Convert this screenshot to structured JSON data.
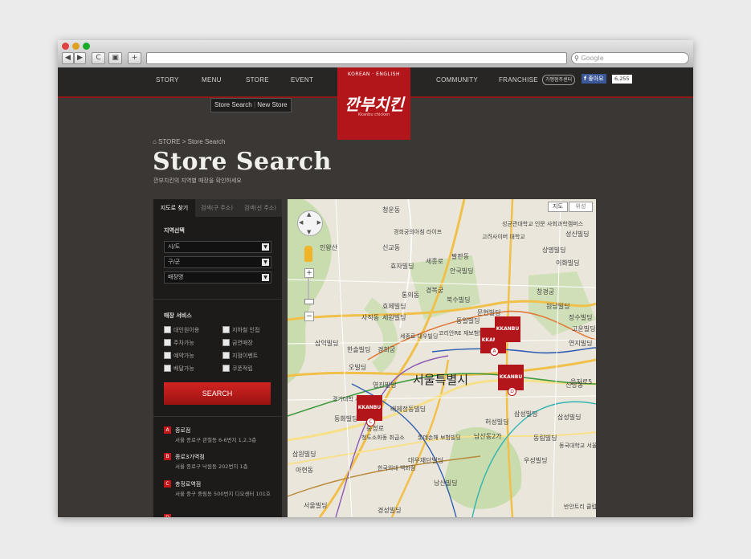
{
  "browser": {
    "search_placeholder": "Google",
    "back": "◀",
    "forward": "▶",
    "reload": "C",
    "add": "+"
  },
  "nav": {
    "left": [
      "STORY",
      "MENU",
      "STORE",
      "EVENT"
    ],
    "right": [
      "COMMUNITY",
      "FRANCHISE"
    ],
    "franchise_badge": "가맹점주센터",
    "like_label": "좋아요",
    "like_count": "6,255"
  },
  "logo": {
    "lang": "KOREAN  ·  ENGLISH",
    "text": "깐부치킨",
    "sub": "Kkanbu chicken"
  },
  "subnav": {
    "search": "Store Search",
    "new": "New Store"
  },
  "breadcrumb": "STORE > Store Search",
  "page": {
    "title": "Store Search",
    "subtitle": "깐부치킨의 지역별 매장을 확인하세요"
  },
  "sidebar": {
    "tabs": [
      "지도로 찾기",
      "검색(구 주소)",
      "검색(신 주소)"
    ],
    "region_label": "지역선택",
    "selects": [
      "시/도",
      "구/군",
      "매장명"
    ],
    "service_label": "매장 서비스",
    "services": [
      "대인원이용",
      "지하철 인접",
      "주차가능",
      "금연매장",
      "예약가능",
      "지점이벤트",
      "배달가능",
      "쿠폰적립"
    ],
    "search_button": "SEARCH",
    "results": [
      {
        "letter": "A",
        "name": "종로점",
        "address": "서울 종로구 관철동 6-6번지 1,2,3층"
      },
      {
        "letter": "B",
        "name": "종로3가역점",
        "address": "서울 종로구 낙원동 202번지 1층"
      },
      {
        "letter": "C",
        "name": "충정로역점",
        "address": "서울 중구 중림동 500번지 디오센터 101호"
      }
    ]
  },
  "map": {
    "type_buttons": [
      "지도",
      "위성"
    ],
    "marker_label": "KKANBU",
    "markers": [
      "A",
      "B",
      "C",
      "D"
    ],
    "center_label": "서울특별시",
    "labels": [
      "청운동",
      "인왕산",
      "신교동",
      "경희궁의아침 라이프",
      "효자빌딩",
      "세종로",
      "팔판동",
      "안국빌딩",
      "고려사이버 대학교",
      "성균관대학교 인문 사회과학캠퍼스",
      "성신빌딩",
      "상명빌딩",
      "이화빌딩",
      "창경궁",
      "원남빌딩",
      "효제빌딩",
      "통의동",
      "경복궁",
      "북수빌딩",
      "사직동",
      "세원빌딩",
      "문현빌딩",
      "동일빌딩",
      "세종로 대우빌딩",
      "코리안RE 재보험빌딩",
      "삼익빌딩",
      "한솔빌딩",
      "경희궁",
      "오빌딩",
      "영진빌딩",
      "경기대학 서울캠퍼스",
      "배제정동빌딩",
      "동화빌딩",
      "을지로5",
      "삼성빌딩",
      "충정로",
      "삼원빌딩",
      "허성빌딩",
      "청도소화동 취급소",
      "롯데손해 보험빌딩",
      "남산동2가",
      "대우재단빌딩",
      "한국외대 백화점",
      "남산빌딩",
      "아현동",
      "서울빌딩",
      "경성빌딩",
      "동림빌딩",
      "우성빌딩",
      "동국대학교 서울캠퍼스",
      "반안트리 클럽앤스파",
      "신당동",
      "삼성빌딩",
      "고운빌딩",
      "장수빌딩",
      "연지빌딩"
    ]
  }
}
